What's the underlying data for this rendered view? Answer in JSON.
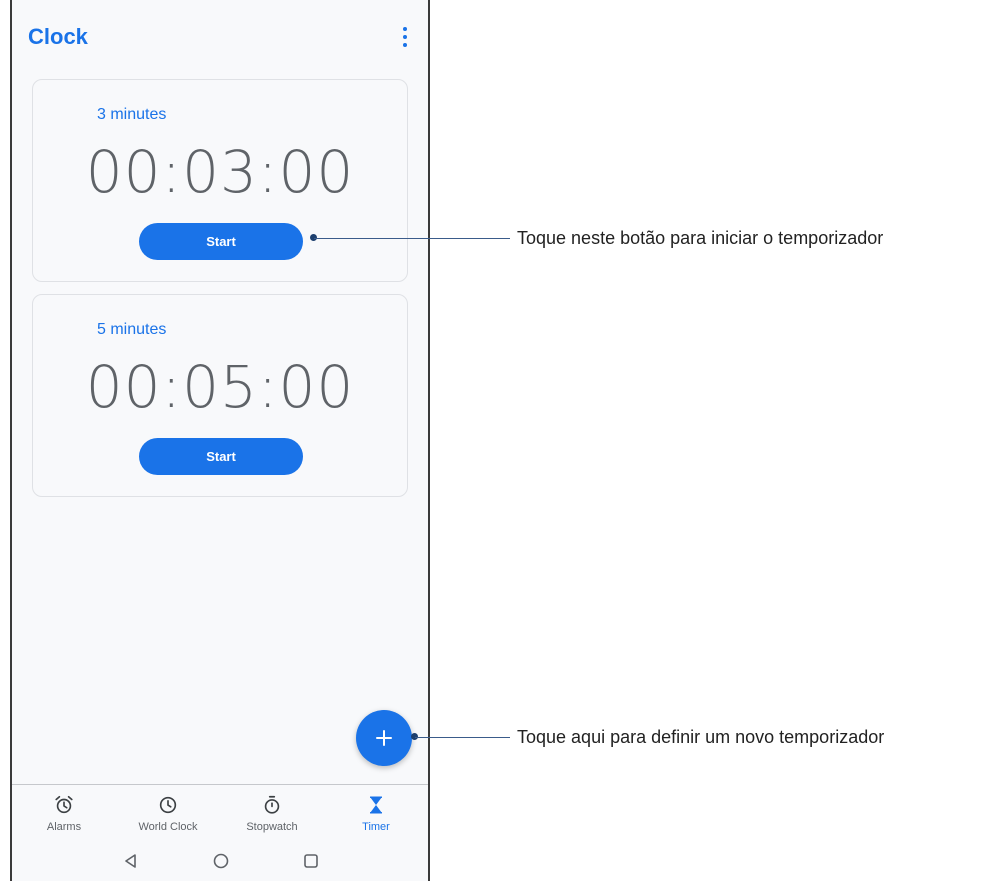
{
  "app": {
    "title": "Clock"
  },
  "colors": {
    "accent": "#1a73e8",
    "text_muted": "#5f6368"
  },
  "timers": [
    {
      "label": "3 minutes",
      "time": "00:03:00",
      "start_label": "Start"
    },
    {
      "label": "5 minutes",
      "time": "00:05:00",
      "start_label": "Start"
    }
  ],
  "fab": {
    "icon": "plus-icon"
  },
  "bottom_nav": [
    {
      "label": "Alarms",
      "icon": "alarm-icon",
      "active": false
    },
    {
      "label": "World Clock",
      "icon": "clock-icon",
      "active": false
    },
    {
      "label": "Stopwatch",
      "icon": "stopwatch-icon",
      "active": false
    },
    {
      "label": "Timer",
      "icon": "hourglass-icon",
      "active": true
    }
  ],
  "system_nav": [
    "back-icon",
    "home-icon",
    "recents-icon"
  ],
  "annotations": {
    "start_button": "Toque neste botão para iniciar o temporizador",
    "add_button": "Toque aqui para definir um novo temporizador"
  }
}
